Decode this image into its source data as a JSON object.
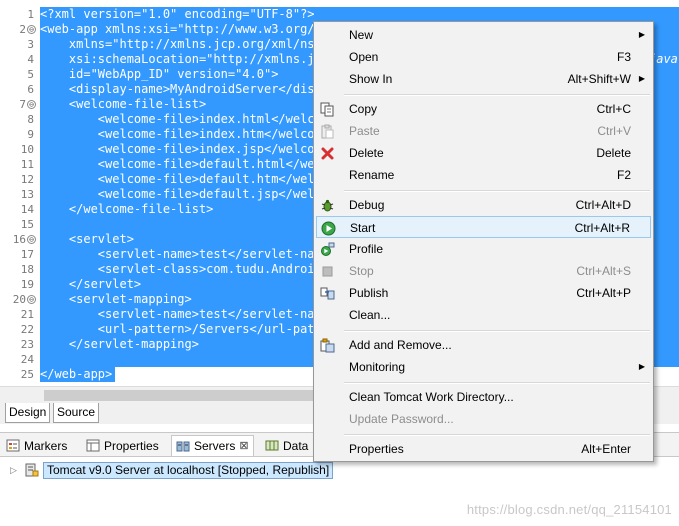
{
  "editor": {
    "line_numbers": [
      "1",
      "2",
      "3",
      "4",
      "5",
      "6",
      "7",
      "8",
      "9",
      "10",
      "11",
      "12",
      "13",
      "14",
      "15",
      "16",
      "17",
      "18",
      "19",
      "20",
      "21",
      "22",
      "23",
      "24",
      "25"
    ],
    "fold_marks": {
      "2": "⊖",
      "7": "⊖",
      "16": "⊖",
      "20": "⊖"
    },
    "code_lines": [
      "<?xml version=\"1.0\" encoding=\"UTF-8\"?>",
      "<web-app xmlns:xsi=\"http://www.w3.org/2",
      "    xmlns=\"http://xmlns.jcp.org/xml/ns/",
      "    xsi:schemaLocation=\"http://xmlns.jc",
      "    id=\"WebApp_ID\" version=\"4.0\">",
      "    <display-name>MyAndroidServer</disp",
      "    <welcome-file-list>",
      "        <welcome-file>index.html</welc",
      "        <welcome-file>index.htm</welcom",
      "        <welcome-file>index.jsp</welcom",
      "        <welcome-file>default.html</we",
      "        <welcome-file>default.htm</welc",
      "        <welcome-file>default.jsp</welc",
      "    </welcome-file-list>",
      "",
      "    <servlet>",
      "        <servlet-name>test</servlet-nam",
      "        <servlet-class>com.tudu.Android",
      "    </servlet>",
      "    <servlet-mapping>",
      "        <servlet-name>test</servlet-nam",
      "        <url-pattern>/Servers</url-patt",
      "    </servlet-mapping>",
      "",
      "</web-app>"
    ],
    "line4_overflow_text": "java",
    "tabs": {
      "design": "Design",
      "source": "Source"
    }
  },
  "views": {
    "tabs": [
      {
        "label": "Markers",
        "icon": "markers-icon"
      },
      {
        "label": "Properties",
        "icon": "properties-icon"
      },
      {
        "label": "Servers",
        "icon": "servers-icon",
        "close": "⊠"
      },
      {
        "label": "Data",
        "icon": "data-icon"
      }
    ],
    "servers": {
      "twisty": "▷",
      "label": "Tomcat v9.0 Server at localhost  [Stopped, Republish]"
    }
  },
  "watermark": "https://blog.csdn.net/qq_21154101",
  "context_menu": {
    "submenu_arrow": "▶",
    "items": {
      "new": {
        "label": "New",
        "shortcut": ""
      },
      "open": {
        "label": "Open",
        "shortcut": "F3"
      },
      "show_in": {
        "label": "Show In",
        "shortcut": "Alt+Shift+W"
      },
      "copy": {
        "label": "Copy",
        "shortcut": "Ctrl+C"
      },
      "paste": {
        "label": "Paste",
        "shortcut": "Ctrl+V"
      },
      "delete": {
        "label": "Delete",
        "shortcut": "Delete"
      },
      "rename": {
        "label": "Rename",
        "shortcut": "F2"
      },
      "debug": {
        "label": "Debug",
        "shortcut": "Ctrl+Alt+D"
      },
      "start": {
        "label": "Start",
        "shortcut": "Ctrl+Alt+R"
      },
      "profile": {
        "label": "Profile",
        "shortcut": ""
      },
      "stop": {
        "label": "Stop",
        "shortcut": "Ctrl+Alt+S"
      },
      "publish": {
        "label": "Publish",
        "shortcut": "Ctrl+Alt+P"
      },
      "clean": {
        "label": "Clean...",
        "shortcut": ""
      },
      "add_remove": {
        "label": "Add and Remove...",
        "shortcut": ""
      },
      "monitoring": {
        "label": "Monitoring",
        "shortcut": ""
      },
      "clean_tomcat": {
        "label": "Clean Tomcat Work Directory...",
        "shortcut": ""
      },
      "update_password": {
        "label": "Update Password...",
        "shortcut": ""
      },
      "properties": {
        "label": "Properties",
        "shortcut": "Alt+Enter"
      }
    }
  },
  "colors": {
    "selection": "#3399ff",
    "menu_bg": "#f2f2f2",
    "menu_highlight": "#e5f1fb",
    "disabled_text": "#8d8d8d"
  }
}
